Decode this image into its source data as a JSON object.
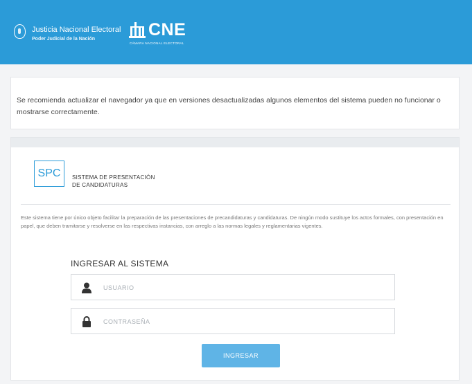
{
  "header": {
    "org_name": "Justicia Nacional Electoral",
    "org_subtitle": "Poder Judicial de la Nación",
    "brand": "CNE",
    "brand_subtitle": "CÁMARA NACIONAL ELECTORAL",
    "background_color": "#2b9bd8",
    "seal_icon": "coat-of-arms-icon",
    "brand_icon": "cne-building-icon"
  },
  "notice": {
    "text": "Se recomienda actualizar el navegador ya que en versiones desactualizadas algunos elementos del sistema pueden no funcionar o mostrarse correctamente."
  },
  "system": {
    "abbr": "SPC",
    "title_line1": "SISTEMA DE PRESENTACIÓN",
    "title_line2": "DE CANDIDATURAS",
    "disclaimer": "Este sistema tiene por único objeto facilitar la preparación de las presentaciones de precandidaturas y candidaturas. De ningún modo sustituye los actos formales, con presentación en papel, que deben tramitarse y resolverse en las respectivas instancias, con arreglo a las normas legales y reglamentarias vigentes."
  },
  "login": {
    "title": "INGRESAR AL SISTEMA",
    "username_placeholder": "USUARIO",
    "username_icon": "user-icon",
    "password_placeholder": "CONTRASEÑA",
    "password_icon": "lock-icon",
    "submit_label": "INGRESAR",
    "button_color": "#5fb4e6"
  }
}
